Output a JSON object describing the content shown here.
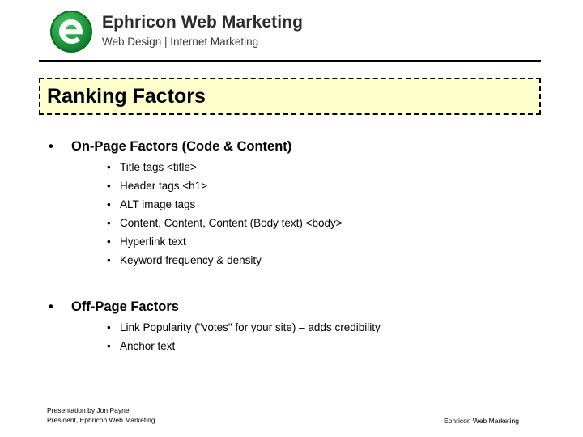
{
  "brand": {
    "logo_icon": "ephricon-e-circle-icon",
    "logo_letter": "e",
    "name": "Ephricon Web Marketing",
    "tagline": "Web Design | Internet Marketing",
    "green": "#1f9b3c",
    "green_dark": "#0d6b27"
  },
  "slide": {
    "title": "Ranking Factors",
    "title_bg": "#ffffcc",
    "title_border": "#000000"
  },
  "content": {
    "groups": [
      {
        "bullet": "•",
        "heading": "On-Page Factors (Code & Content)",
        "items": [
          {
            "bullet": "•",
            "text": "Title tags <title>"
          },
          {
            "bullet": "•",
            "text": "Header tags <h1>"
          },
          {
            "bullet": "•",
            "text": "ALT image tags"
          },
          {
            "bullet": "•",
            "text": "Content, Content, Content (Body text) <body>"
          },
          {
            "bullet": "•",
            "text": "Hyperlink text"
          },
          {
            "bullet": "•",
            "text": "Keyword frequency & density"
          }
        ]
      },
      {
        "bullet": "•",
        "heading": "Off-Page Factors",
        "items": [
          {
            "bullet": "•",
            "text": "Link Popularity (\"votes\" for your site) – adds credibility"
          },
          {
            "bullet": "•",
            "text": "Anchor text"
          }
        ]
      }
    ]
  },
  "footer": {
    "left_line1": "Presentation by Jon Payne",
    "left_line2": "President, Ephricon Web Marketing",
    "right": "Ephricon Web Marketing"
  }
}
